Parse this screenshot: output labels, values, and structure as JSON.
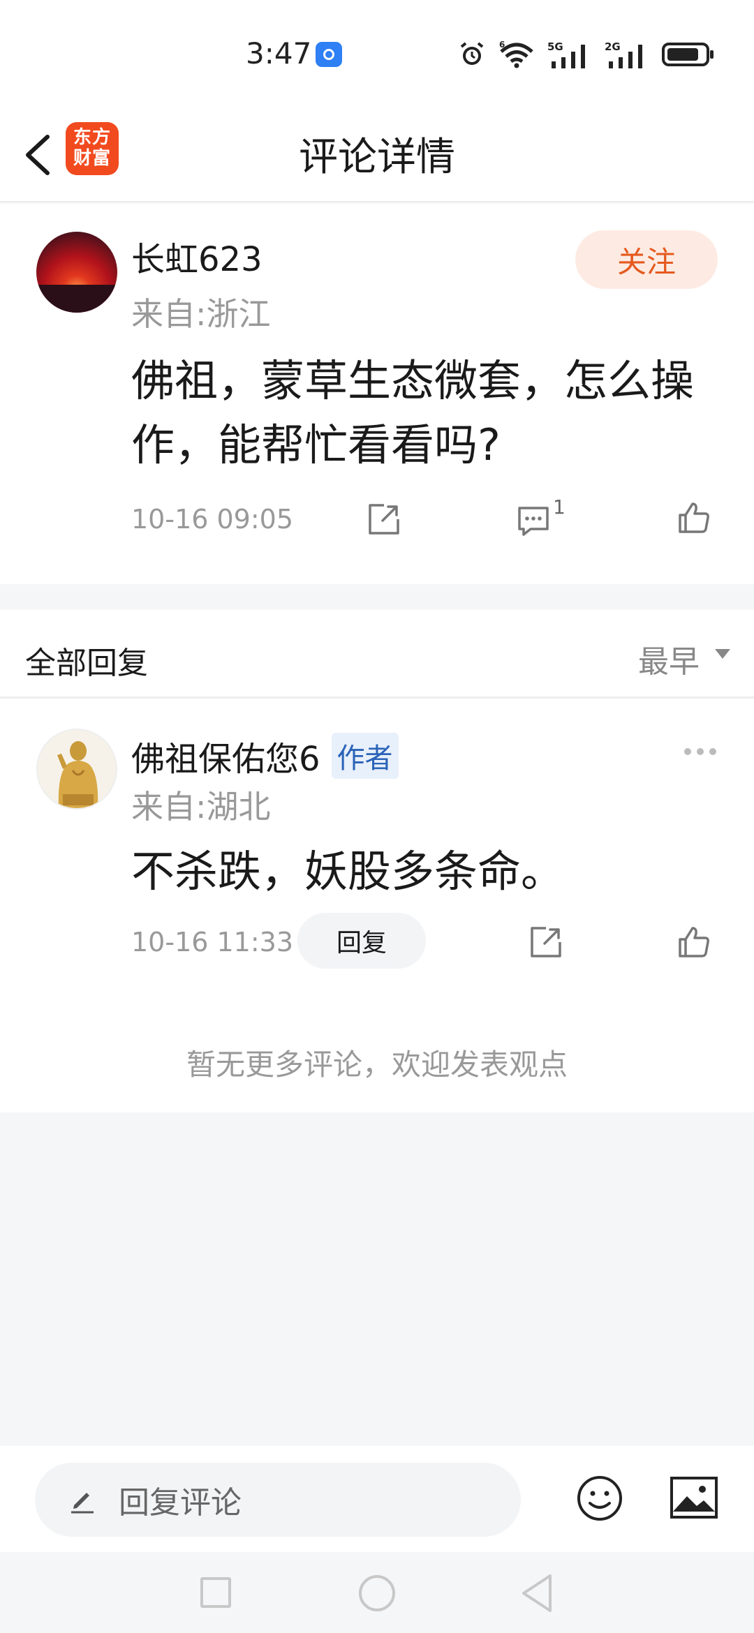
{
  "status_bar": {
    "time": "3:47",
    "icons": [
      "app-notification-icon",
      "alarm-icon",
      "wifi-icon",
      "signal-5g-icon",
      "signal-2g-icon",
      "battery-icon"
    ],
    "network_5g": "5G",
    "network_2g": "2G",
    "wifi_badge": "6"
  },
  "header": {
    "title": "评论详情",
    "logo_line1": "东方",
    "logo_line2": "财富",
    "brand_color": "#f24a1f"
  },
  "comment": {
    "username": "长虹623",
    "location": "来自:浙江",
    "follow_label": "关注",
    "text": "佛祖，蒙草生态微套，怎么操作，能帮忙看看吗?",
    "time": "10-16 09:05",
    "reply_count": "1",
    "accent_color": "#e55a1f"
  },
  "replies_header": {
    "title": "全部回复",
    "sort_label": "最早"
  },
  "replies": [
    {
      "username": "佛祖保佑您6",
      "badge": "作者",
      "location": "来自:湖北",
      "text": "不杀跌，妖股多条命。",
      "time": "10-16 11:33",
      "reply_label": "回复"
    }
  ],
  "no_more_text": "暂无更多评论，欢迎发表观点",
  "bottom_bar": {
    "input_placeholder": "回复评论"
  }
}
